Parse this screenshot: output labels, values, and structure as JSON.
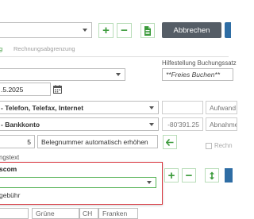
{
  "toolbar": {
    "cancel_label": "Abbrechen"
  },
  "tabs": [
    {
      "label": "g",
      "active": true
    },
    {
      "label": "Rechnungsabgrenzung",
      "active": false
    }
  ],
  "booking_helper": {
    "label": "Hilfestellung Buchungssatz",
    "value": "**Freies Buchen**"
  },
  "date": {
    "value": ".5.2025"
  },
  "account1": {
    "value": "- Telefon, Telefax, Internet",
    "side_label": "Aufwand"
  },
  "account2": {
    "value": "- Bankkonto",
    "amount": "-80'391.25",
    "side_label": "Abnahme"
  },
  "document_number": {
    "value": "5",
    "auto_label": "Belegnummer automatisch erhöhen"
  },
  "right_checkbox_label": "Rechn",
  "booking_text": {
    "label": "ngstext",
    "value": "scom",
    "dropdown_option": "gebühr"
  },
  "bottom_row": {
    "field1": "Grüne",
    "field2": "CH",
    "field3": "Franken"
  }
}
